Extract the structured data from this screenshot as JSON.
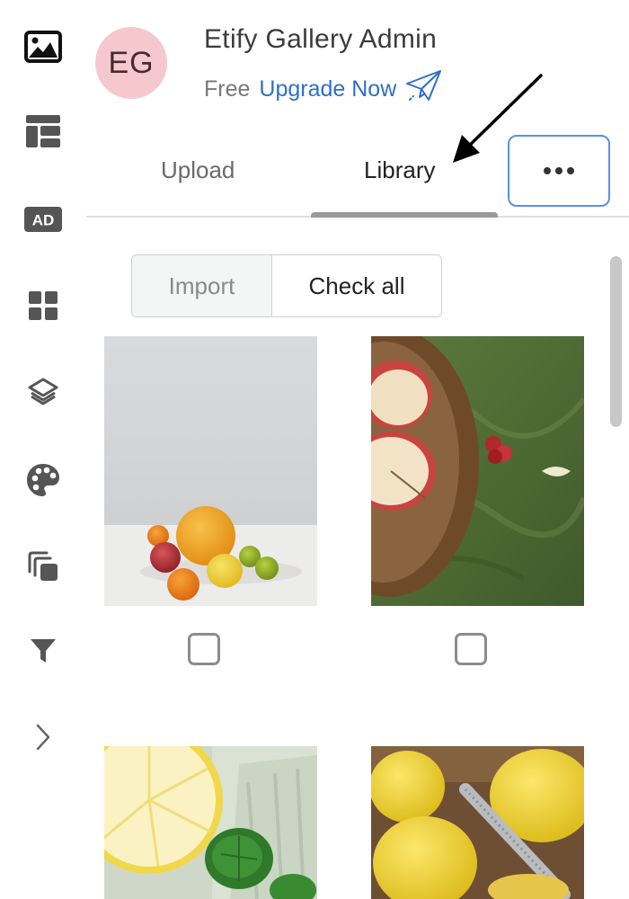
{
  "account": {
    "initials": "EG",
    "name": "Etify Gallery Admin",
    "plan": "Free",
    "upgrade_label": "Upgrade Now",
    "avatar_color": "#f4c8cd"
  },
  "sidebar": {
    "items": [
      {
        "icon": "image-icon"
      },
      {
        "icon": "layout-icon"
      },
      {
        "icon": "ad-icon",
        "label": "AD"
      },
      {
        "icon": "grid-icon"
      },
      {
        "icon": "layers-icon"
      },
      {
        "icon": "palette-icon"
      },
      {
        "icon": "copy-icon"
      },
      {
        "icon": "filter-icon"
      },
      {
        "icon": "chevron-right-icon"
      }
    ]
  },
  "tabs": {
    "items": [
      {
        "label": "Upload",
        "active": false
      },
      {
        "label": "Library",
        "active": true
      }
    ],
    "more_icon": "ellipsis-icon"
  },
  "actions": {
    "import_label": "Import",
    "check_all_label": "Check all"
  },
  "gallery": {
    "images": [
      {
        "subject": "citrus-fruits-on-white-table",
        "checked": false
      },
      {
        "subject": "sliced-apples-and-berries-on-green-cloth",
        "checked": false
      },
      {
        "subject": "lemon-slice-and-mint-in-glass",
        "checked": false
      },
      {
        "subject": "lemons-with-grater",
        "checked": false
      }
    ]
  },
  "colors": {
    "link": "#2f6fc4",
    "focus_border": "#5b8ee6",
    "icon": "#555555"
  }
}
